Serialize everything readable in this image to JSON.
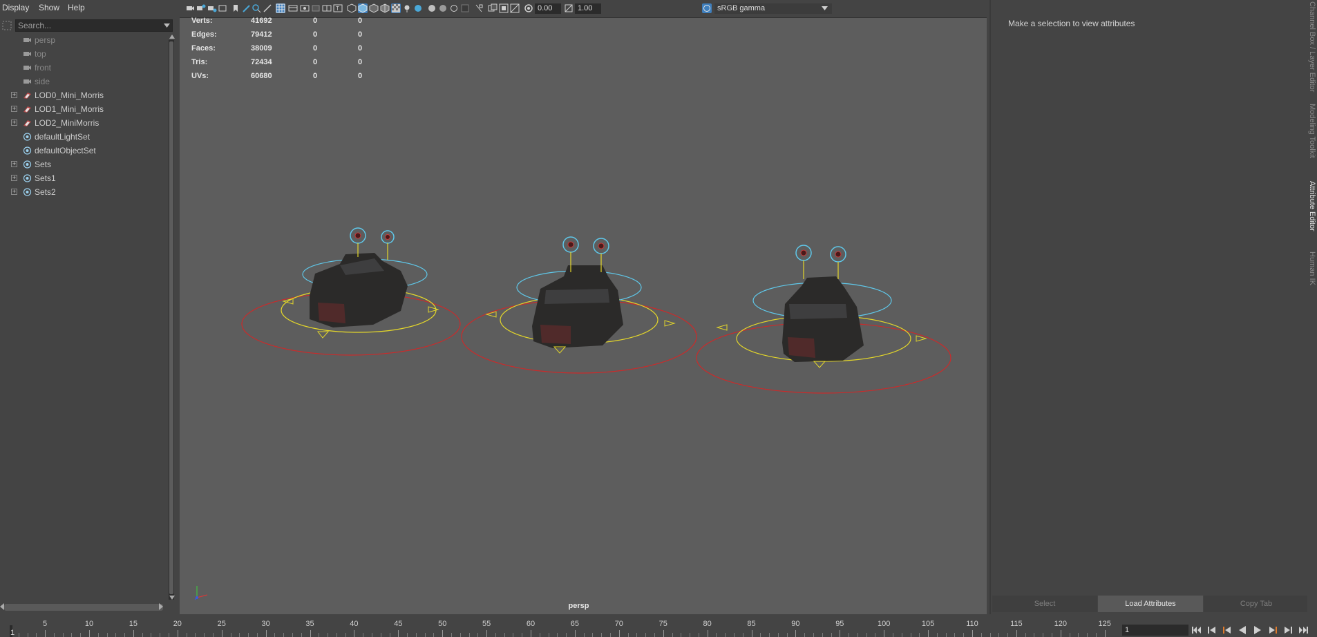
{
  "outliner": {
    "menu": [
      "Display",
      "Show",
      "Help"
    ],
    "search_placeholder": "Search...",
    "items": [
      {
        "label": "persp",
        "icon": "camera-icon",
        "expandable": false,
        "dim": true
      },
      {
        "label": "top",
        "icon": "camera-icon",
        "expandable": false,
        "dim": true
      },
      {
        "label": "front",
        "icon": "camera-icon",
        "expandable": false,
        "dim": true
      },
      {
        "label": "side",
        "icon": "camera-icon",
        "expandable": false,
        "dim": true
      },
      {
        "label": "LOD0_Mini_Morris",
        "icon": "mesh-group-icon",
        "expandable": true,
        "dim": false
      },
      {
        "label": "LOD1_Mini_Morris",
        "icon": "mesh-group-icon",
        "expandable": true,
        "dim": false
      },
      {
        "label": "LOD2_MiniMorris",
        "icon": "mesh-group-icon",
        "expandable": true,
        "dim": false
      },
      {
        "label": "defaultLightSet",
        "icon": "set-icon",
        "expandable": false,
        "dim": false
      },
      {
        "label": "defaultObjectSet",
        "icon": "set-icon",
        "expandable": false,
        "dim": false
      },
      {
        "label": "Sets",
        "icon": "set-icon",
        "expandable": true,
        "dim": false
      },
      {
        "label": "Sets1",
        "icon": "set-icon",
        "expandable": true,
        "dim": false
      },
      {
        "label": "Sets2",
        "icon": "set-icon",
        "expandable": true,
        "dim": false
      }
    ]
  },
  "viewport": {
    "exposure": "0.00",
    "gamma": "1.00",
    "color_space": "sRGB gamma",
    "camera_label": "persp",
    "hud": [
      {
        "label": "Verts:",
        "values": [
          "41692",
          "0",
          "0"
        ]
      },
      {
        "label": "Edges:",
        "values": [
          "79412",
          "0",
          "0"
        ]
      },
      {
        "label": "Faces:",
        "values": [
          "38009",
          "0",
          "0"
        ]
      },
      {
        "label": "Tris:",
        "values": [
          "72434",
          "0",
          "0"
        ]
      },
      {
        "label": "UVs:",
        "values": [
          "60680",
          "0",
          "0"
        ]
      }
    ]
  },
  "attribute_editor": {
    "message": "Make a selection to view attributes",
    "buttons": [
      {
        "label": "Select",
        "active": false
      },
      {
        "label": "Load Attributes",
        "active": true
      },
      {
        "label": "Copy Tab",
        "active": false
      }
    ]
  },
  "side_tabs": [
    {
      "label": "Channel Box / Layer Editor",
      "active": false
    },
    {
      "label": "Modeling Toolkit",
      "active": false
    },
    {
      "label": "Attribute Editor",
      "active": true
    },
    {
      "label": "Human IK",
      "active": false
    }
  ],
  "timeline": {
    "ticks": [
      "5",
      "10",
      "15",
      "20",
      "25",
      "30",
      "35",
      "40",
      "45",
      "50",
      "55",
      "60",
      "65",
      "70",
      "75",
      "80",
      "85",
      "90",
      "95",
      "100",
      "105",
      "110",
      "115",
      "120",
      "125"
    ],
    "start_marker": "1",
    "current_frame": "1"
  }
}
